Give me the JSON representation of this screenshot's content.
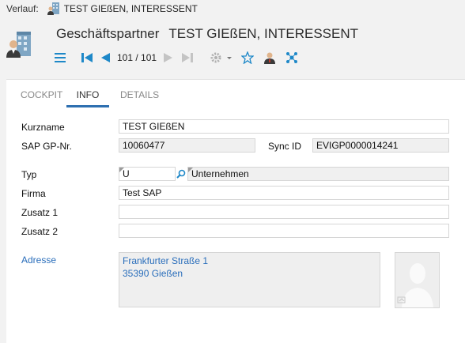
{
  "history": {
    "label": "Verlauf:",
    "crumb": "TEST GIEßEN, INTERESSENT"
  },
  "header": {
    "type_title": "Geschäftspartner",
    "object_title": "TEST GIEßEN, INTERESSENT"
  },
  "toolbar": {
    "pager": "101 / 101",
    "accent_color": "#1e88c8"
  },
  "tabs": [
    {
      "label": "COCKPIT",
      "active": false
    },
    {
      "label": "INFO",
      "active": true
    },
    {
      "label": "DETAILS",
      "active": false
    }
  ],
  "form": {
    "kurzname_label": "Kurzname",
    "kurzname_value": "TEST GIEßEN",
    "sap_label": "SAP GP-Nr.",
    "sap_value": "10060477",
    "sync_label": "Sync ID",
    "sync_value": "EVIGP0000014241",
    "typ_label": "Typ",
    "typ_code": "U",
    "typ_text": "Unternehmen",
    "firma_label": "Firma",
    "firma_value": "Test SAP",
    "zusatz1_label": "Zusatz 1",
    "zusatz1_value": "",
    "zusatz2_label": "Zusatz 2",
    "zusatz2_value": "",
    "adresse_label": "Adresse",
    "adresse_line1": "Frankfurter Straße 1",
    "adresse_line2": "35390 Gießen"
  }
}
